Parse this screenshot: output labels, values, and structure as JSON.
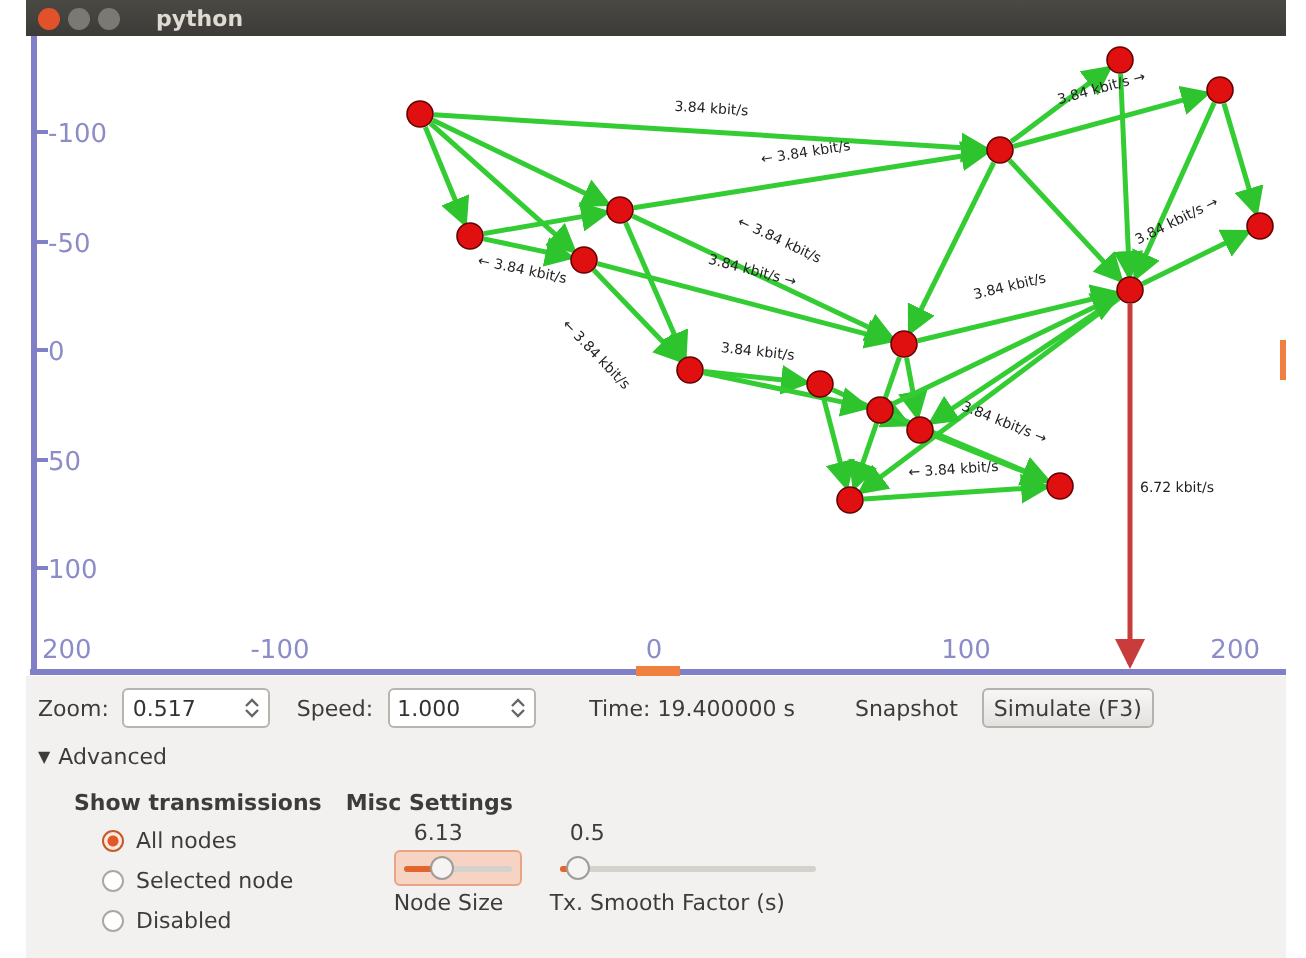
{
  "window": {
    "title": "python"
  },
  "canvas": {
    "y_axis": [
      "-100",
      "-50",
      "0",
      "50",
      "100"
    ],
    "x_axis": [
      "200",
      "-100",
      "0",
      "100",
      "200"
    ],
    "links": [
      {
        "label": "3.84 kbit/s →"
      },
      {
        "label": "← 3.84 kbit/s"
      },
      {
        "label": "3.84 kbit/s"
      },
      {
        "label": "← 3.84 kbit/s"
      },
      {
        "label": "3.84 kbit/s →"
      },
      {
        "label": "3.84 kbit/s"
      },
      {
        "label": "← 3.84 kbit/s"
      },
      {
        "label": "3.84 kbit/s →"
      },
      {
        "label": "3.84 kbit/s →"
      },
      {
        "label": "← 3.84 kbit/s"
      },
      {
        "label": "3.84 kbit/s"
      },
      {
        "label": "← 3.84 kbit/s"
      }
    ],
    "uplink": {
      "label": "6.72 kbit/s"
    }
  },
  "toolbar": {
    "zoom_label": "Zoom:",
    "zoom_value": "0.517",
    "speed_label": "Speed:",
    "speed_value": "1.000",
    "time": "Time: 19.400000 s",
    "snapshot": "Snapshot",
    "simulate": "Simulate (F3)"
  },
  "advanced": {
    "label": "Advanced",
    "expanded": true,
    "toggle": "▼"
  },
  "transmissions": {
    "title": "Show transmissions",
    "options": [
      {
        "label": "All nodes",
        "selected": true
      },
      {
        "label": "Selected node",
        "selected": false
      },
      {
        "label": "Disabled",
        "selected": false
      }
    ]
  },
  "misc": {
    "title": "Misc Settings",
    "sliders": [
      {
        "name": "Node Size",
        "reading": "6.13",
        "level": 0.35,
        "focused": true
      },
      {
        "name": "Tx. Smooth Factor (s)",
        "reading": "0.5",
        "level": 0.07,
        "focused": false
      }
    ]
  }
}
